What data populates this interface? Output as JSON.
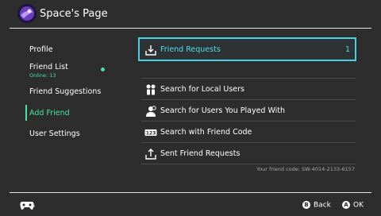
{
  "header": {
    "title": "Space's Page"
  },
  "sidebar": {
    "items": [
      {
        "label": "Profile"
      },
      {
        "label": "Friend List",
        "sub": "Online: 13"
      },
      {
        "label": "Friend Suggestions"
      },
      {
        "label": "Add Friend"
      },
      {
        "label": "User Settings"
      }
    ]
  },
  "main": {
    "rows": [
      {
        "label": "Friend Requests",
        "count": "1",
        "icon": "inbox-download-icon"
      },
      {
        "label": "Search for Local Users",
        "icon": "local-users-icon"
      },
      {
        "label": "Search for Users You Played With",
        "icon": "played-with-icon"
      },
      {
        "label": "Search with Friend Code",
        "icon": "friend-code-123-icon"
      },
      {
        "label": "Sent Friend Requests",
        "icon": "outbox-upload-icon"
      }
    ],
    "friend_code": "Your friend code: SW-4014-2133-6157"
  },
  "footer": {
    "back_key": "B",
    "back_label": "Back",
    "ok_key": "A",
    "ok_label": "OK"
  },
  "colors": {
    "accent": "#46e3a3",
    "selection": "#47d0e3",
    "background": "#2d2d2d"
  }
}
